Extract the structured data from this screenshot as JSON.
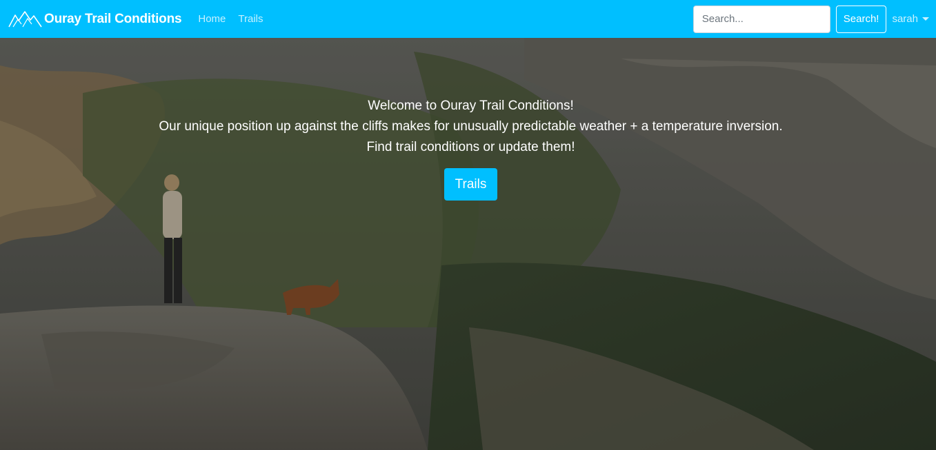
{
  "navbar": {
    "brand": "Ouray Trail Conditions",
    "links": [
      "Home",
      "Trails"
    ],
    "search": {
      "placeholder": "Search...",
      "value": ""
    },
    "search_button": "Search!",
    "user": "sarah"
  },
  "hero": {
    "lines": [
      "Welcome to Ouray Trail Conditions!",
      "Our unique position up against the cliffs makes for unusually predictable weather + a temperature inversion.",
      "Find trail conditions or update them!"
    ],
    "button": "Trails"
  },
  "colors": {
    "accent": "#00bfff",
    "text_light": "#ffffff"
  },
  "icons": {
    "brand": "mountains-icon",
    "user_menu": "caret-down-icon"
  }
}
